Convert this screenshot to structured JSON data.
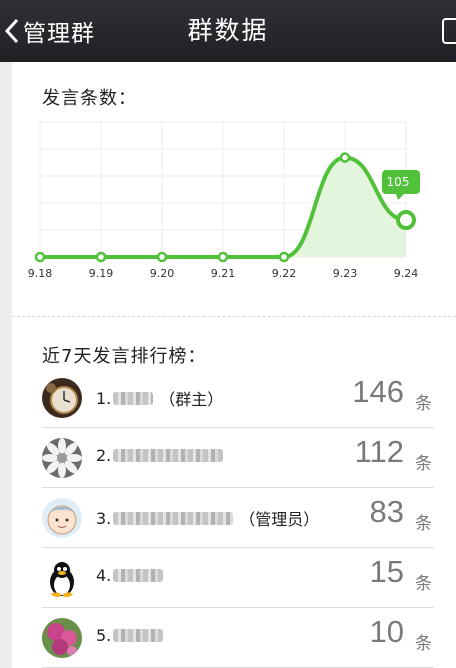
{
  "header": {
    "back_label": "管理群",
    "title": "群数据"
  },
  "chart_section": {
    "title": "发言条数："
  },
  "chart_data": {
    "type": "area",
    "title": "发言条数：",
    "categories": [
      "9.18",
      "9.19",
      "9.20",
      "9.21",
      "9.22",
      "9.23",
      "9.24"
    ],
    "values": [
      0,
      0,
      0,
      0,
      0,
      140,
      52
    ],
    "ylim": [
      0,
      190
    ],
    "grid": true,
    "series_color": "#52c13a",
    "fill_color": "#e3f5dc",
    "callout": {
      "category": "9.24",
      "label": "105"
    }
  },
  "ranking": {
    "title": "近7天发言排行榜：",
    "unit": "条",
    "items": [
      {
        "index": "1.",
        "blur_width": 40,
        "role": "（群主）",
        "count": "146",
        "avatar": "clock-avatar"
      },
      {
        "index": "2.",
        "blur_width": 110,
        "role": "",
        "count": "112",
        "avatar": "flower-avatar"
      },
      {
        "index": "3.",
        "blur_width": 120,
        "role": "（管理员）",
        "count": "83",
        "avatar": "cartoon-avatar"
      },
      {
        "index": "4.",
        "blur_width": 50,
        "role": "",
        "count": "15",
        "avatar": "penguin-avatar"
      },
      {
        "index": "5.",
        "blur_width": 50,
        "role": "",
        "count": "10",
        "avatar": "pink-flower-avatar"
      }
    ]
  }
}
